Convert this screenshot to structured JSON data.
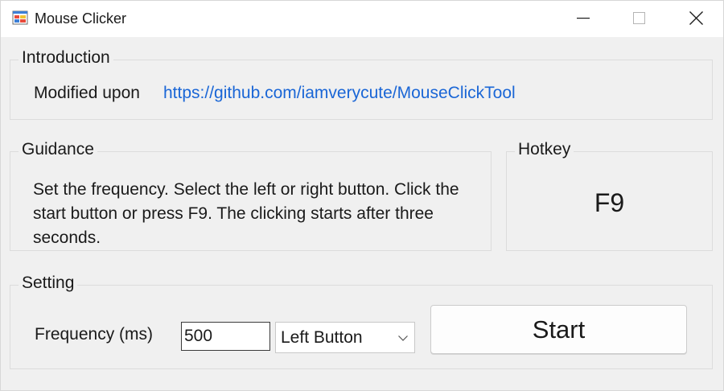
{
  "window": {
    "title": "Mouse Clicker",
    "app_icon": "window-form-icon",
    "controls": [
      "minimize-icon",
      "maximize-icon",
      "close-icon"
    ]
  },
  "introduction": {
    "group_title": "Introduction",
    "label": "Modified upon",
    "link_text": "https://github.com/iamverycute/MouseClickTool"
  },
  "guidance": {
    "group_title": "Guidance",
    "text": "Set the frequency. Select the left or right button. Click the start button or press F9. The clicking starts after three seconds."
  },
  "hotkey": {
    "group_title": "Hotkey",
    "value": "F9"
  },
  "setting": {
    "group_title": "Setting",
    "frequency_label": "Frequency (ms)",
    "frequency_value": "500",
    "button_select_value": "Left Button",
    "start_label": "Start"
  },
  "colors": {
    "link": "#1a66d6",
    "titlebar": "#ffffff",
    "client_bg": "#f0f0f0"
  }
}
